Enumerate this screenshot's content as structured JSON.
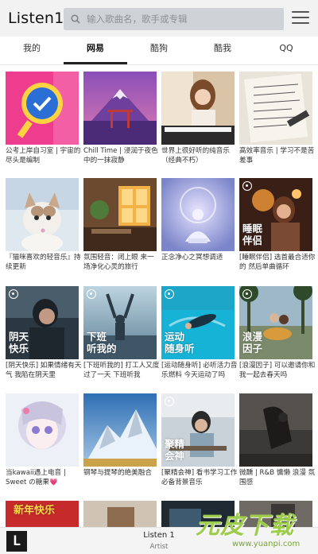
{
  "app": {
    "title": "Listen1"
  },
  "search": {
    "placeholder": "输入歌曲名，歌手或专辑"
  },
  "tabs": [
    {
      "label": "我的"
    },
    {
      "label": "网易",
      "active": true
    },
    {
      "label": "酷狗"
    },
    {
      "label": "酷我"
    },
    {
      "label": "QQ"
    }
  ],
  "playlists": [
    {
      "title": "公考上岸自习室 | 宇宙的尽头是编制",
      "badge": ""
    },
    {
      "title": "Chill Time | 浸润于夜色中的一抹寂静",
      "badge": ""
    },
    {
      "title": "世界上很好听的纯音乐（经典不朽）",
      "badge": ""
    },
    {
      "title": "高效率音乐 | 学习不是苦差事",
      "badge": ""
    },
    {
      "title": "『猫咪喜欢的轻音乐』持续更新",
      "badge": ""
    },
    {
      "title": "氛围轻音：闭上眼 来一场净化心灵的旅行",
      "badge": ""
    },
    {
      "title": "正念净心之冥想调适",
      "badge": ""
    },
    {
      "title": "[睡眠伴侣] 选首最合适你的 然后单曲循环",
      "badge": "睡眠\n伴侣"
    },
    {
      "title": "[阴天快乐] 如果情绪有天气 我陷在阴天里",
      "badge": "阴天\n快乐"
    },
    {
      "title": "[下班听我的] 打工人又度过了一天 下班听我",
      "badge": "下班\n听我的"
    },
    {
      "title": "[运动随身听] 必听活力音乐燃料 今天运动了吗",
      "badge": "运动\n随身听"
    },
    {
      "title": "[浪漫因子] 可以邀请你和我一起去春天吗",
      "badge": "浪漫\n因子"
    },
    {
      "title": "当kawaii遇上电音 | Sweet の糖果💗",
      "badge": ""
    },
    {
      "title": "钢琴与提琴的绝美融合",
      "badge": ""
    },
    {
      "title": "[聚精会神] 看书学习工作必备背景音乐",
      "badge": "聚精\n会神"
    },
    {
      "title": "微醺 | R&B 慵懒 浪漫 氛围感",
      "badge": ""
    },
    {
      "title": "",
      "badge": "新年快乐"
    },
    {
      "title": "",
      "badge": ""
    },
    {
      "title": "",
      "badge": ""
    },
    {
      "title": "",
      "badge": ""
    }
  ],
  "player": {
    "logo": "L",
    "song": "Listen 1",
    "artist": "Artist"
  },
  "watermark": {
    "text": "元皮下载",
    "url": "www.yuanpi.com"
  },
  "colors": {
    "header_bg": "#f2f2f2",
    "search_bg": "#cfd3d8",
    "indicator": "#222222",
    "watermark": "#9ccc4a"
  }
}
